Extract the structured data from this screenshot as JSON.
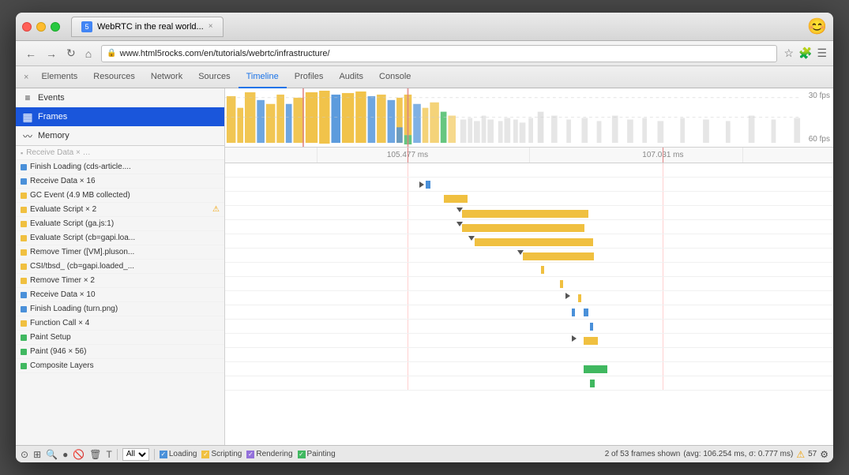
{
  "browser": {
    "tab_title": "WebRTC in the real world...",
    "tab_favicon": "5",
    "url": "www.html5rocks.com/en/tutorials/webrtc/infrastructure/",
    "window_emoji": "😊"
  },
  "devtools": {
    "close_btn": "×",
    "tabs": [
      {
        "label": "Elements",
        "active": false
      },
      {
        "label": "Resources",
        "active": false
      },
      {
        "label": "Network",
        "active": false
      },
      {
        "label": "Sources",
        "active": false
      },
      {
        "label": "Timeline",
        "active": true
      },
      {
        "label": "Profiles",
        "active": false
      },
      {
        "label": "Audits",
        "active": false
      },
      {
        "label": "Console",
        "active": false
      }
    ]
  },
  "sidebar": {
    "items": [
      {
        "label": "Events",
        "icon": "≡",
        "active": false
      },
      {
        "label": "Frames",
        "icon": "▦",
        "active": true
      },
      {
        "label": "Memory",
        "icon": "~",
        "active": false
      }
    ]
  },
  "timeline": {
    "fps_30": "30 fps",
    "fps_60": "60 fps",
    "timestamp_left": "105.477 ms",
    "timestamp_right": "107.031 ms"
  },
  "events": [
    {
      "label": "Finish Loading (cds-article....",
      "color": "#4a90d9",
      "warn": false
    },
    {
      "label": "Receive Data × 16",
      "color": "#4a90d9",
      "warn": false
    },
    {
      "label": "GC Event (4.9 MB collected)",
      "color": "#f0c040",
      "warn": false
    },
    {
      "label": "Evaluate Script × 2",
      "color": "#f0c040",
      "warn": true
    },
    {
      "label": "Evaluate Script (ga.js:1)",
      "color": "#f0c040",
      "warn": false
    },
    {
      "label": "Evaluate Script (cb=gapi.loa...",
      "color": "#f0c040",
      "warn": false
    },
    {
      "label": "Remove Timer ([VM].pluson...",
      "color": "#f0c040",
      "warn": false
    },
    {
      "label": "CSI/tbsd_ (cb=gapi.loaded_...",
      "color": "#f0c040",
      "warn": false
    },
    {
      "label": "Remove Timer × 2",
      "color": "#f0c040",
      "warn": false
    },
    {
      "label": "Receive Data × 10",
      "color": "#4a90d9",
      "warn": false
    },
    {
      "label": "Finish Loading (turn.png)",
      "color": "#4a90d9",
      "warn": false
    },
    {
      "label": "Function Call × 4",
      "color": "#f0c040",
      "warn": false
    },
    {
      "label": "Paint Setup",
      "color": "#40b860",
      "warn": false
    },
    {
      "label": "Paint (946 × 56)",
      "color": "#40b860",
      "warn": false
    },
    {
      "label": "Composite Layers",
      "color": "#40b860",
      "warn": false
    }
  ],
  "status_bar": {
    "filter_all": "All",
    "loading_label": "Loading",
    "scripting_label": "Scripting",
    "rendering_label": "Rendering",
    "painting_label": "Painting",
    "frames_info": "2 of 53 frames shown",
    "avg_info": "(avg: 106.254 ms, σ: 0.777 ms)",
    "frame_count": "57"
  }
}
